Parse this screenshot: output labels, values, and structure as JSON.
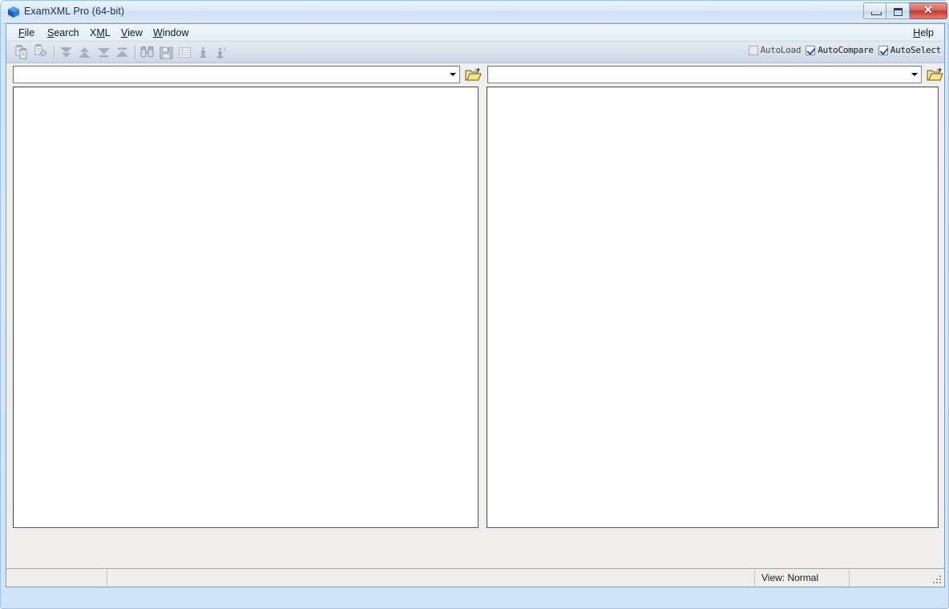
{
  "window": {
    "title": "ExamXML Pro (64-bit)",
    "app_icon": "blue-cube-icon",
    "controls": {
      "minimize": "minimize-button",
      "maximize": "maximize-button",
      "close_glyph": "✕"
    }
  },
  "menubar": {
    "items": [
      {
        "label": "File",
        "mnemonic_index": 0
      },
      {
        "label": "Search",
        "mnemonic_index": 0
      },
      {
        "label": "XML",
        "mnemonic_index": 1
      },
      {
        "label": "View",
        "mnemonic_index": 0
      },
      {
        "label": "Window",
        "mnemonic_index": 0
      }
    ],
    "help": {
      "label": "Help",
      "mnemonic_index": 0
    }
  },
  "toolbar": {
    "buttons": [
      {
        "name": "compare-documents-icon",
        "tooltip": "Compare",
        "enabled": false
      },
      {
        "name": "merge-documents-icon",
        "tooltip": "Merge",
        "enabled": false
      },
      {
        "name": "first-difference-icon",
        "tooltip": "First Difference",
        "enabled": false
      },
      {
        "name": "last-difference-icon",
        "tooltip": "Last Difference",
        "enabled": false
      },
      {
        "name": "next-difference-icon",
        "tooltip": "Next Difference",
        "enabled": false
      },
      {
        "name": "previous-difference-icon",
        "tooltip": "Previous Difference",
        "enabled": false
      },
      {
        "name": "find-icon",
        "tooltip": "Find",
        "enabled": false
      },
      {
        "name": "save-icon",
        "tooltip": "Save",
        "enabled": false
      },
      {
        "name": "table-view-icon",
        "tooltip": "Table View",
        "enabled": false
      },
      {
        "name": "info-icon",
        "tooltip": "Info",
        "enabled": false
      },
      {
        "name": "info-alt-icon",
        "tooltip": "Info 1",
        "enabled": false
      }
    ],
    "checkboxes": [
      {
        "label": "AutoLoad",
        "checked": false,
        "enabled": false
      },
      {
        "label": "AutoCompare",
        "checked": true,
        "enabled": true
      },
      {
        "label": "AutoSelect",
        "checked": true,
        "enabled": true
      }
    ]
  },
  "panels": {
    "left": {
      "path_value": "",
      "path_placeholder": "",
      "open_button_label": "open-folder-icon",
      "content": ""
    },
    "right": {
      "path_value": "",
      "path_placeholder": "",
      "open_button_label": "open-folder-icon",
      "content": ""
    }
  },
  "statusbar": {
    "cells": [
      "",
      "",
      "View: Normal",
      ""
    ]
  },
  "colors": {
    "frame": "#cfe4f7",
    "titlebar_text": "#16334d",
    "close_button": "#c1382e",
    "toolbar_bg": "#d9e1ed",
    "client_bg": "#f0efee",
    "pane_bg": "#ffffff",
    "checkbox_check": "#1458b4",
    "folder_icon": "#e8c84f"
  }
}
